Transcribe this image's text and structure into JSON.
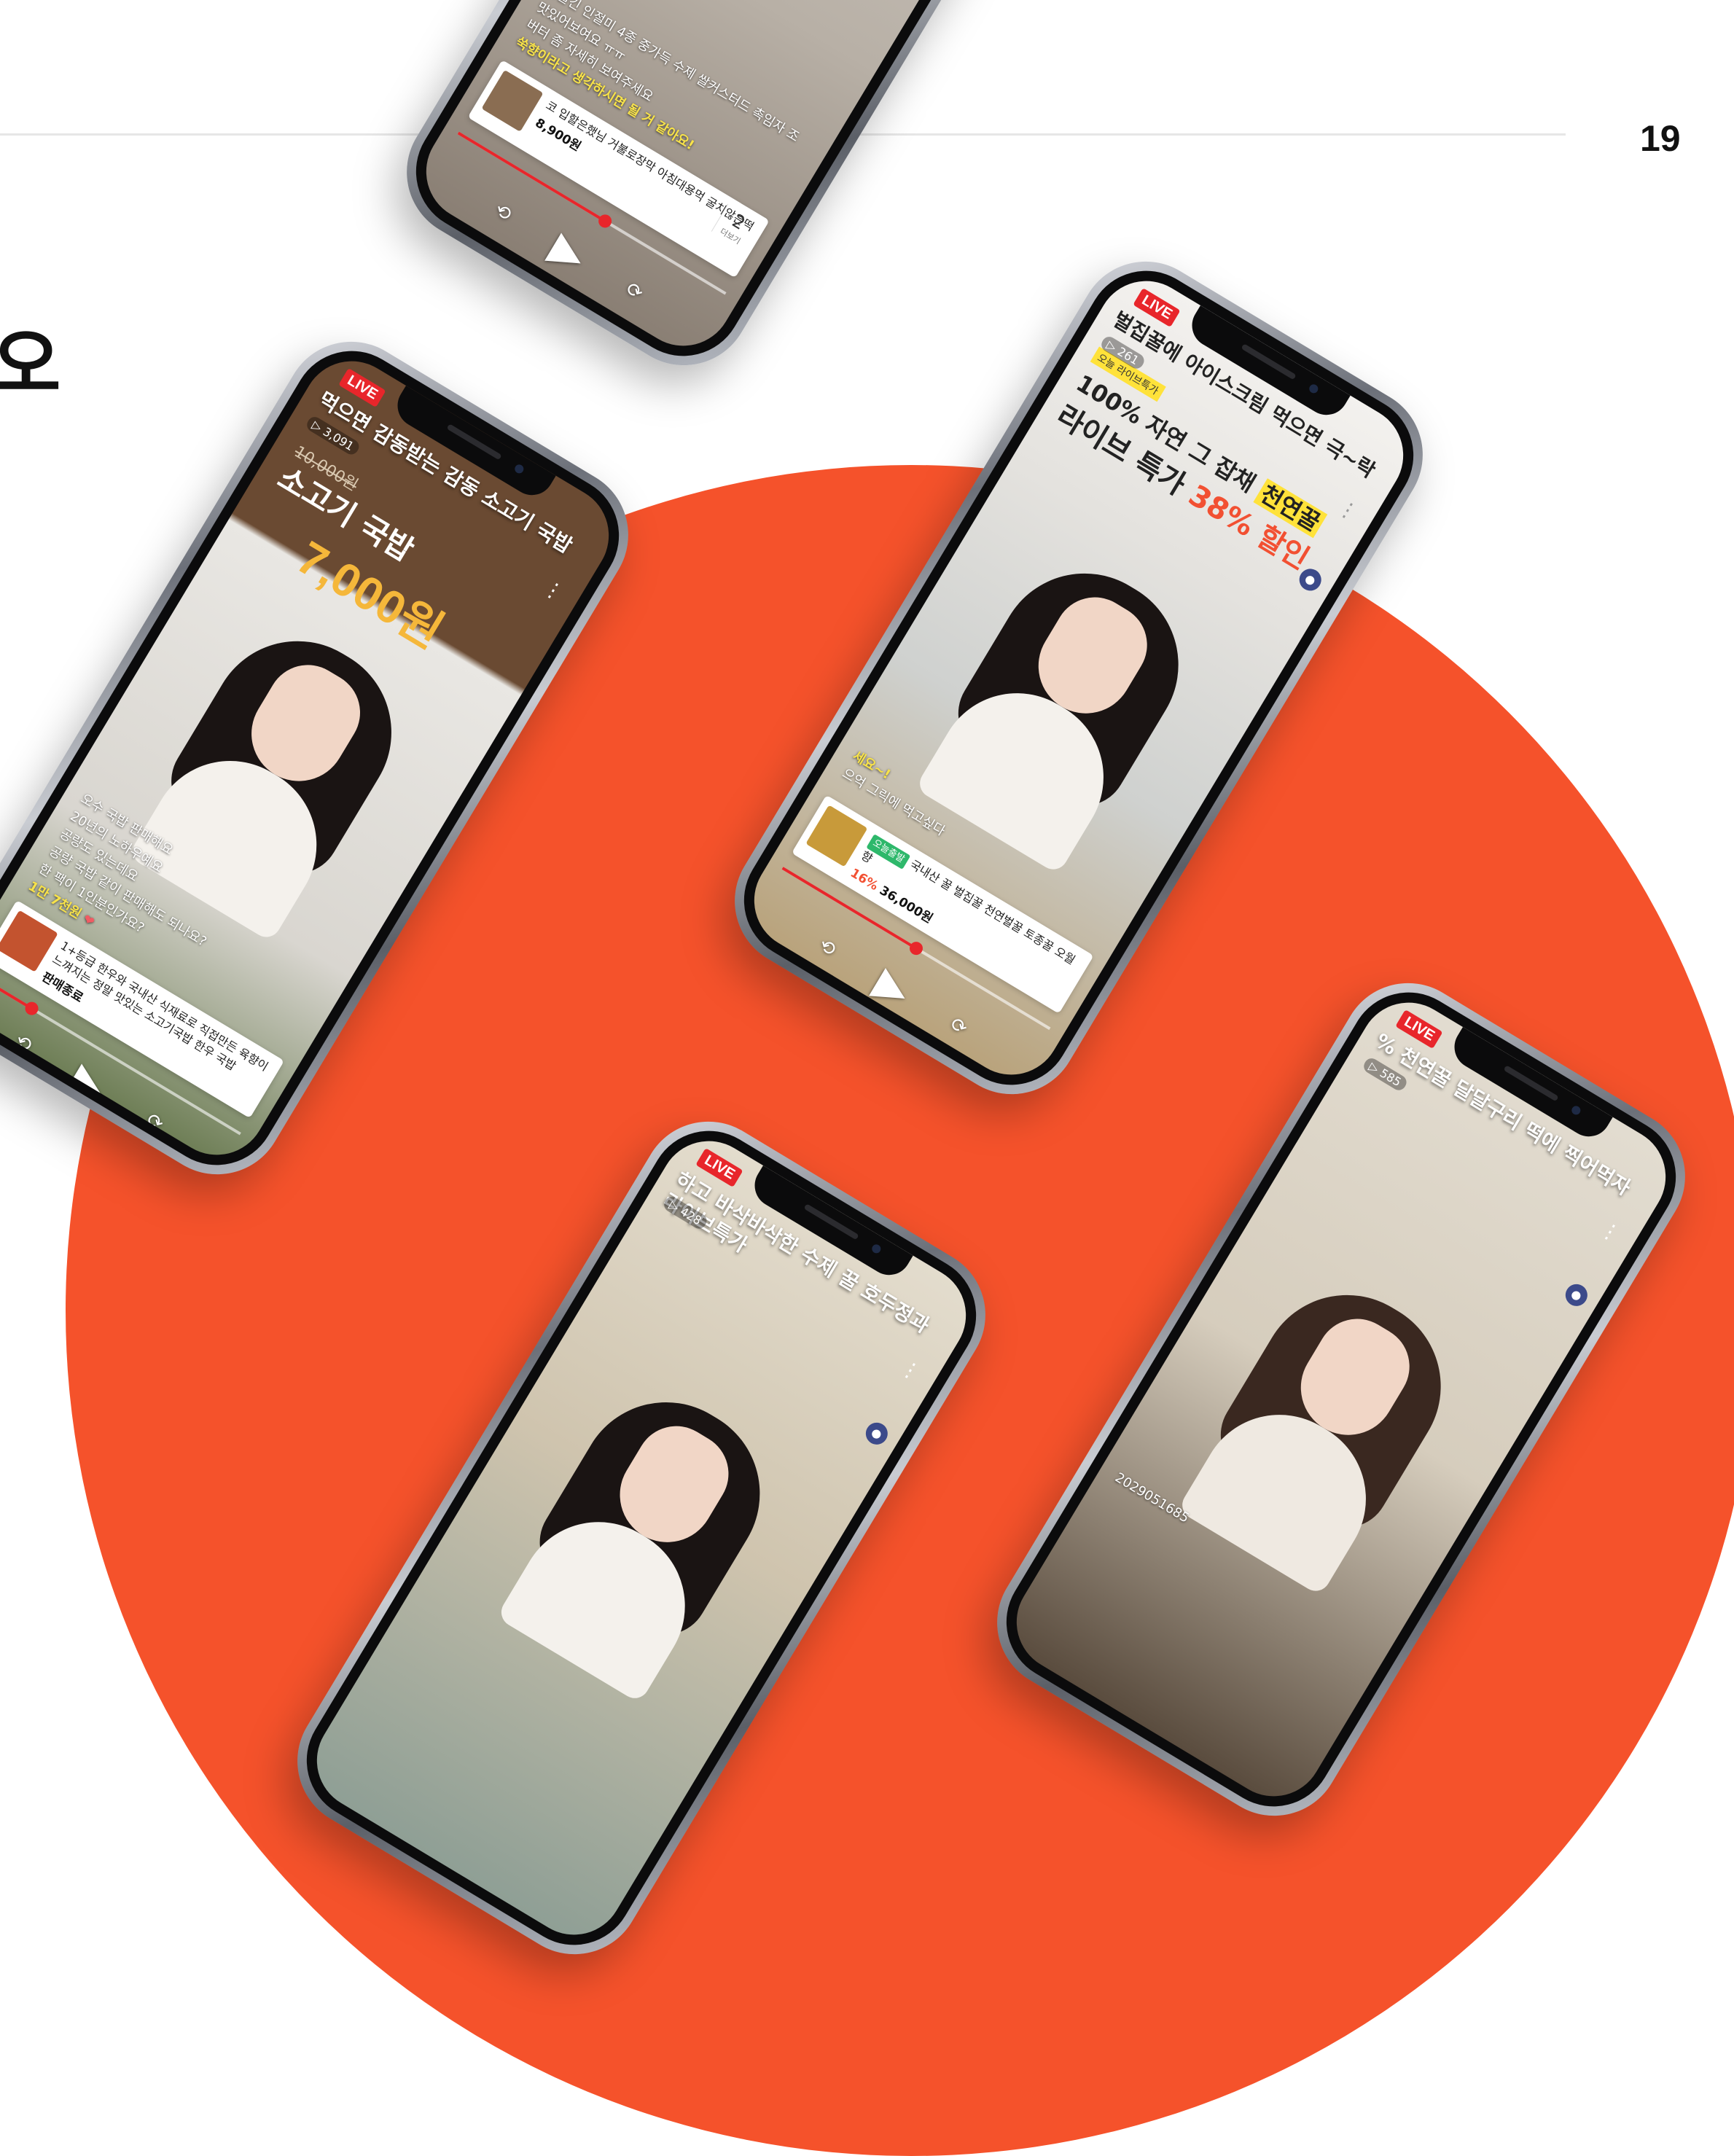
{
  "page": {
    "number": "19",
    "heading_fragment": "오",
    "accent": "#f5522b"
  },
  "phones": [
    {
      "id": "kimbap",
      "chat": [
        {
          "text": "돌굴긴 인절미 4종 중가득 수제 쌀커스터드 촉임자 조",
          "hl": false
        },
        {
          "text": "맛있어보여요 ㅠㅠ",
          "hl": false
        },
        {
          "text": "버터 좀 자세히 보여주세요",
          "hl": false
        },
        {
          "text": "쑥향이라고 생각하시면 될 거 같아요!",
          "hl": true
        }
      ],
      "product": {
        "name": "코 입할은했님 거불로장막 아침대용먹 굴치않은떡",
        "price": "8,900원",
        "more_count": "2",
        "more_label": "더보기"
      },
      "controls": {
        "rewind": "⟲",
        "play": "▶",
        "forward": "⟳"
      },
      "progress": 0.55
    },
    {
      "id": "gukbap",
      "live": "LIVE",
      "title": "먹으면 감동받는 감동 소고기 국밥",
      "viewers": "▷ 3,091",
      "banner": {
        "old_price": "10,000원",
        "line": "소고기 국밥",
        "price": "7,000원"
      },
      "chat": [
        {
          "text": "오수 국밥 판매해요",
          "hl": false
        },
        {
          "text": "20년의 노하우예요",
          "hl": false
        },
        {
          "text": "공량도 있는데요",
          "hl": false
        },
        {
          "text": "공량 국밥 같이 판매해도 되나요?",
          "hl": false
        },
        {
          "text": "한 팩이 1인분인가요?",
          "hl": false
        },
        {
          "text": "1만 7천원",
          "hl": true,
          "heart": "❤"
        }
      ],
      "product": {
        "name": "1+등급 한우와 국내산 식재료로 직접만든 육향이 느껴지는 정말 맛있는 소고기국밥 한우 국밥",
        "price": "판매종료"
      },
      "controls": {
        "rewind": "⟲",
        "play": "▶",
        "forward": "⟳"
      },
      "progress": 0.22
    },
    {
      "id": "honey-ice",
      "live": "LIVE",
      "title": "벌집꿀에 아이스크림 먹으면 극~락",
      "viewers": "▷ 261",
      "banner": {
        "tag": "오늘 라이브특가",
        "line1": "100% 자연 그 잡채",
        "highlight": "천연꿀",
        "line2": "라이브 특가",
        "pct": "38% 할인"
      },
      "chat": [
        {
          "text": "세요~!",
          "hl": true
        },
        {
          "text": "으억 그릭에 먹고싶다",
          "hl": false
        }
      ],
      "product": {
        "badge": "오늘출발",
        "name": "국내산 꿀 벌집꿀 천연벌꿀 토종꿀 오월향",
        "discount": "16%",
        "price": "36,000원"
      },
      "controls": {
        "rewind": "⟲",
        "play": "▶",
        "forward": "⟳"
      },
      "progress": 0.5
    },
    {
      "id": "walnut",
      "live": "LIVE",
      "title": "하고 바삭바삭한 수제 꿀 호두정과 라이브특가",
      "viewers": "▷ 428"
    },
    {
      "id": "honey-rice",
      "live": "LIVE",
      "title": "% 천연꿀 달달구리 떡에 찍어먹자",
      "viewers": "▷ 585",
      "footer_text": "2029051685"
    }
  ]
}
